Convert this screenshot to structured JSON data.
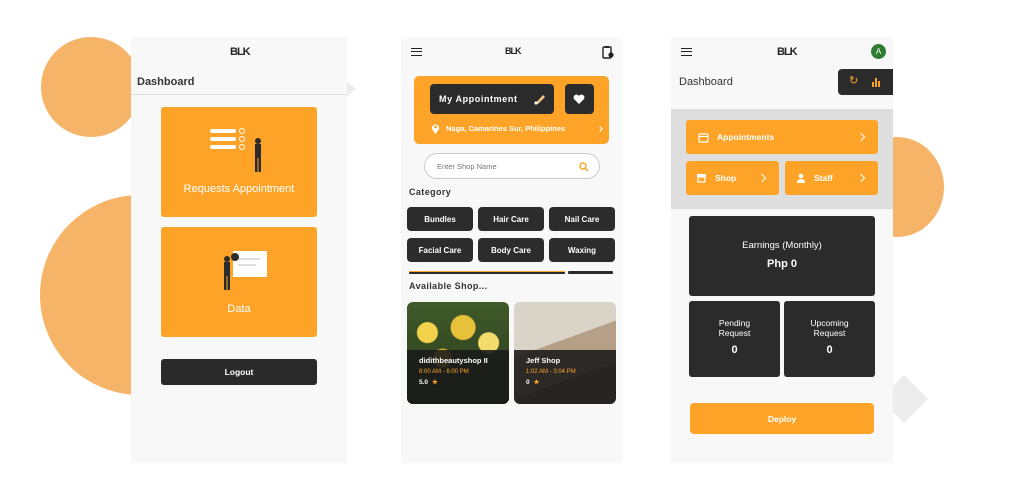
{
  "screen1": {
    "logo": "BLK",
    "title": "Dashboard",
    "card_requests": "Requests Appointment",
    "card_data": "Data",
    "logout": "Logout"
  },
  "screen2": {
    "logo": "BLK",
    "my_appointment": "My Appointment",
    "location": "Naga, Camarines Sur, Philippines",
    "search_placeholder": "Enter Shop Name",
    "category_heading": "Category",
    "categories": [
      "Bundles",
      "Hair Care",
      "Nail Care",
      "Facial Care",
      "Body Care",
      "Waxing"
    ],
    "available_heading": "Available Shop...",
    "shops": [
      {
        "name": "didithbeautyshop II",
        "hours": "8:00 AM - 6:00 PM",
        "rating": "5.0"
      },
      {
        "name": "Jeff Shop",
        "hours": "1:02 AM - 3:04 PM",
        "rating": "0"
      }
    ]
  },
  "screen3": {
    "logo": "BLK",
    "avatar": "A",
    "title": "Dashboard",
    "appointments": "Appointments",
    "shop": "Shop",
    "staff": "Staff",
    "earnings_label": "Earnings (Monthly)",
    "earnings_value": "Php 0",
    "pending_label": "Pending Request",
    "pending_value": "0",
    "upcoming_label": "Upcoming Request",
    "upcoming_value": "0",
    "deploy": "Deploy"
  },
  "colors": {
    "accent": "#fda428",
    "dark": "#2a2a2a",
    "avatar": "#2e7d32"
  }
}
